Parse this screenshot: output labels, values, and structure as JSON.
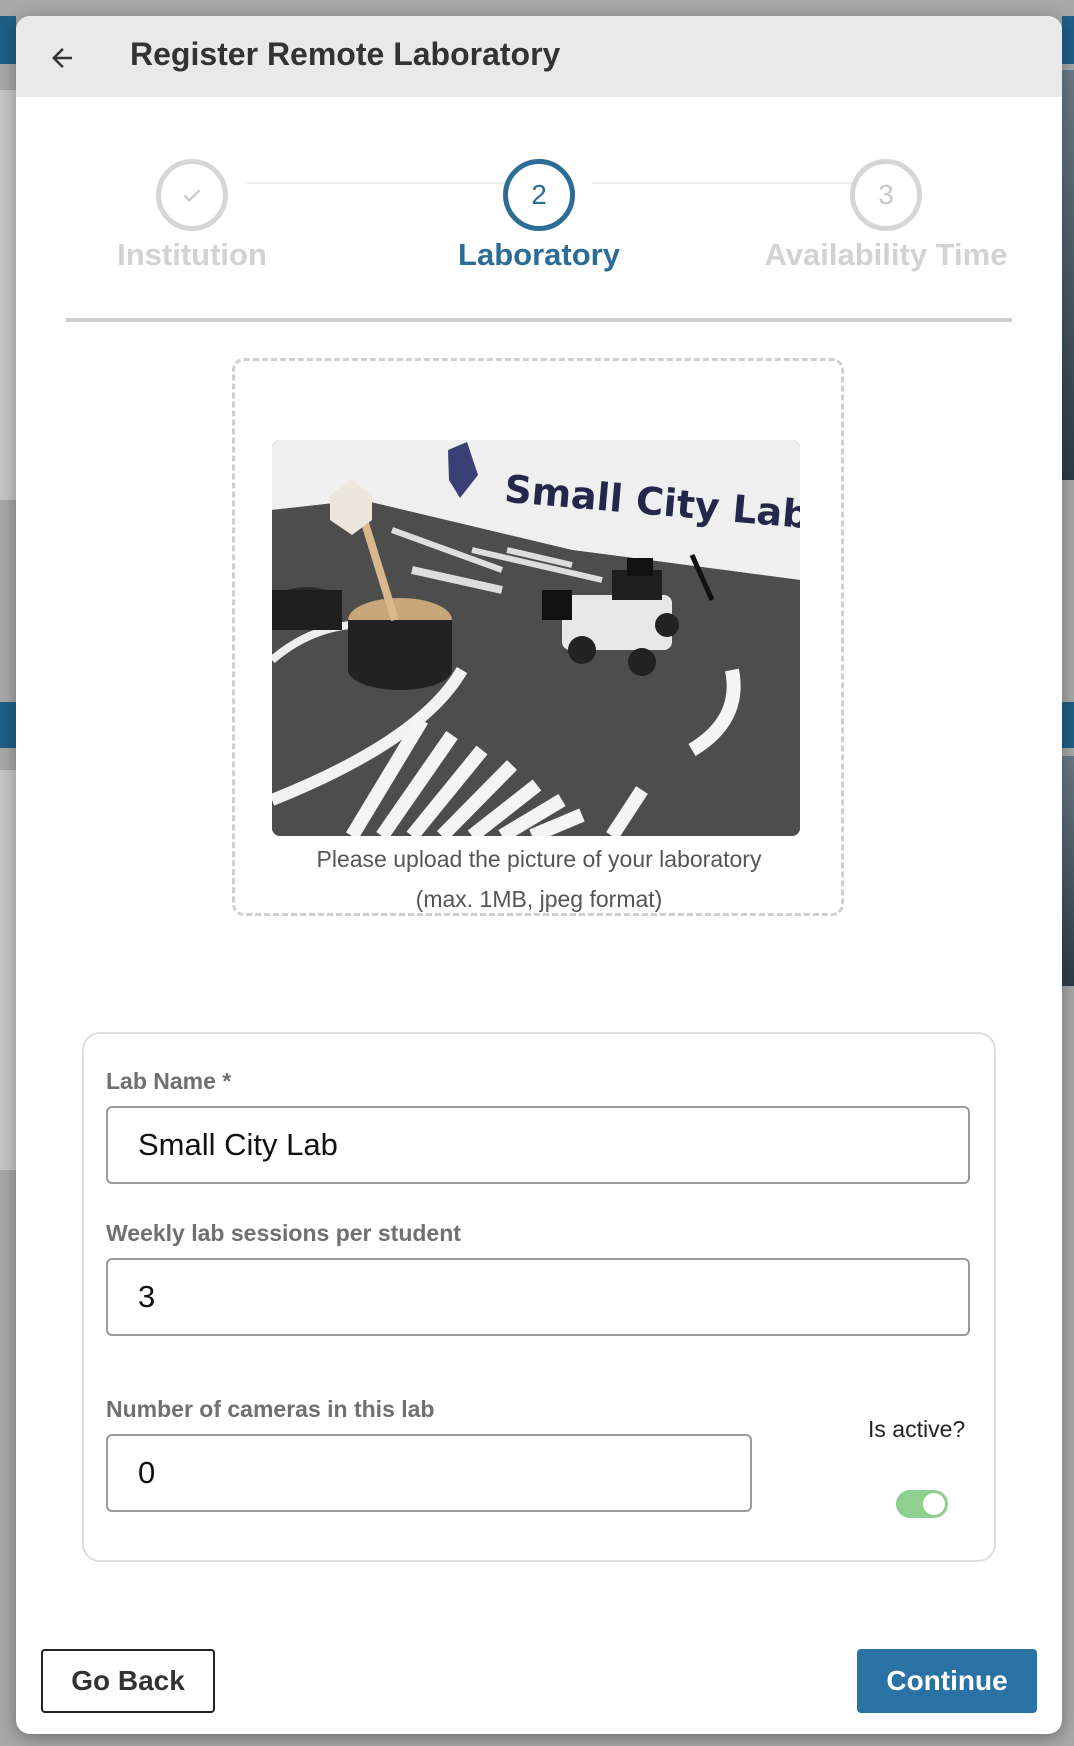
{
  "header": {
    "title": "Register Remote Laboratory"
  },
  "stepper": {
    "steps": [
      {
        "number": "✓",
        "label": "Institution",
        "state": "completed"
      },
      {
        "number": "2",
        "label": "Laboratory",
        "state": "active"
      },
      {
        "number": "3",
        "label": "Availability Time",
        "state": "upcoming"
      }
    ]
  },
  "upload": {
    "photo_caption_text": "Small City Lab",
    "hint_line1": "Please upload the picture of your laboratory",
    "hint_line2": "(max. 1MB, jpeg format)"
  },
  "form": {
    "lab_name": {
      "label": "Lab Name *",
      "value": "Small City Lab"
    },
    "weekly_sessions": {
      "label": "Weekly lab sessions per student",
      "value": "3"
    },
    "cameras": {
      "label": "Number of cameras in this lab",
      "value": "0"
    },
    "is_active": {
      "label": "Is active?",
      "checked": true
    }
  },
  "actions": {
    "go_back": "Go Back",
    "continue": "Continue"
  },
  "colors": {
    "accent": "#2d6c95",
    "primary_button": "#2b72a4",
    "toggle_on": "#8fcf8f"
  }
}
